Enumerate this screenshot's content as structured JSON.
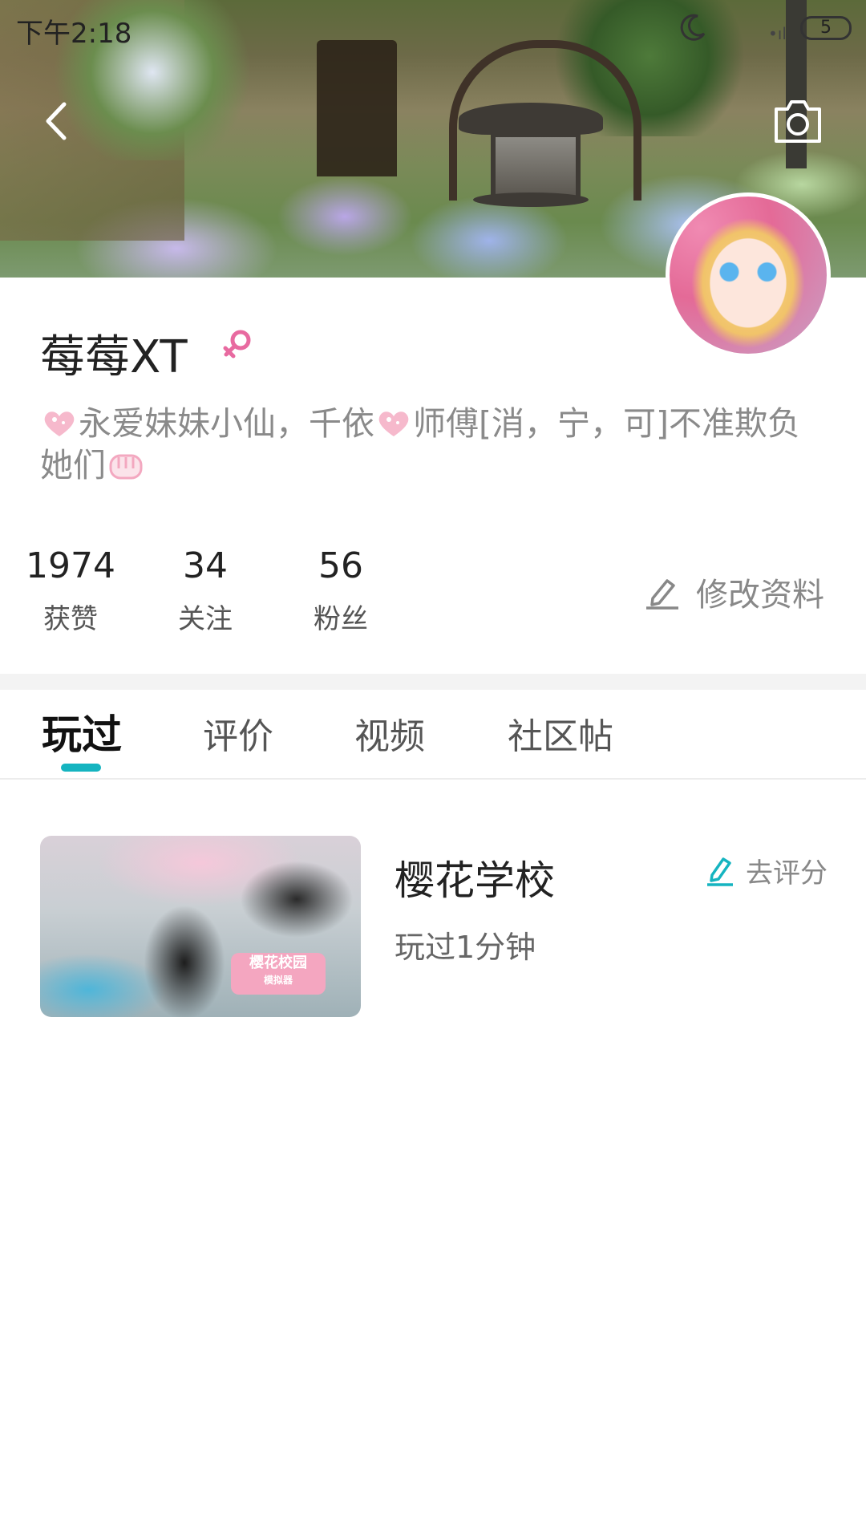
{
  "status_bar": {
    "time": "下午2:18",
    "battery": "5"
  },
  "header": {
    "back_icon": "chevron-left-icon",
    "camera_icon": "camera-icon"
  },
  "profile": {
    "username": "莓莓XT",
    "gender_icon": "female-icon",
    "bio_segments": [
      "永爱妹妹小仙，千依",
      "师傅[消，宁，可]不准欺负她们"
    ],
    "stats": [
      {
        "value": "1974",
        "label": "获赞"
      },
      {
        "value": "34",
        "label": "关注"
      },
      {
        "value": "56",
        "label": "粉丝"
      }
    ],
    "edit_label": "修改资料"
  },
  "tabs": [
    {
      "label": "玩过",
      "active": true
    },
    {
      "label": "评价",
      "active": false
    },
    {
      "label": "视频",
      "active": false
    },
    {
      "label": "社区帖",
      "active": false
    }
  ],
  "games": [
    {
      "title": "樱花学校",
      "playtime": "玩过1分钟",
      "rate_label": "去评分",
      "thumb_logo_main": "樱花校园",
      "thumb_logo_sub": "模拟器"
    }
  ],
  "colors": {
    "accent": "#15b4c0",
    "gender": "#e86aa0"
  }
}
